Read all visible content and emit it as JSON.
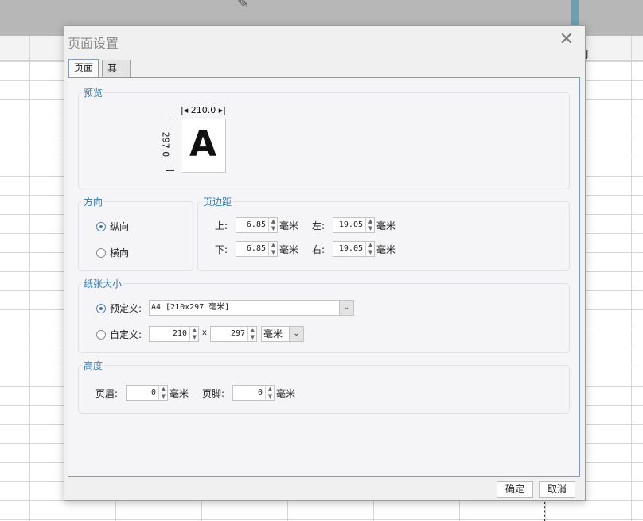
{
  "background": {
    "column_letter": "J"
  },
  "dialog": {
    "title": "页面设置",
    "close_glyph": "✕",
    "tabs": [
      {
        "label": "页面",
        "active": true
      },
      {
        "label": "其他",
        "active": false
      }
    ],
    "preview": {
      "title": "预览",
      "width_label": "|◂ 210.0 ▸|",
      "height_label": "297.0",
      "letter": "A"
    },
    "orientation": {
      "title": "方向",
      "options": [
        {
          "label": "纵向",
          "selected": true
        },
        {
          "label": "横向",
          "selected": false
        }
      ]
    },
    "margins": {
      "title": "页边距",
      "top_label": "上:",
      "top_value": "6.85",
      "left_label": "左:",
      "left_value": "19.05",
      "bottom_label": "下:",
      "bottom_value": "6.85",
      "right_label": "右:",
      "right_value": "19.05",
      "unit": "毫米"
    },
    "paper": {
      "title": "纸张大小",
      "predefined_label": "预定义:",
      "predefined_selected": true,
      "predefined_value": "A4 [210x297 毫米]",
      "custom_label": "自定义:",
      "custom_selected": false,
      "custom_width": "210",
      "times": "x",
      "custom_height": "297",
      "custom_unit": "毫米"
    },
    "height": {
      "title": "高度",
      "header_label": "页眉:",
      "header_value": "0",
      "footer_label": "页脚:",
      "footer_value": "0",
      "unit": "毫米"
    },
    "buttons": {
      "ok": "确定",
      "cancel": "取消"
    }
  },
  "colors": {
    "group_title": "#2d7fc0",
    "tab_border": "#7c9cc4",
    "radio_on": "#3c74c0"
  }
}
